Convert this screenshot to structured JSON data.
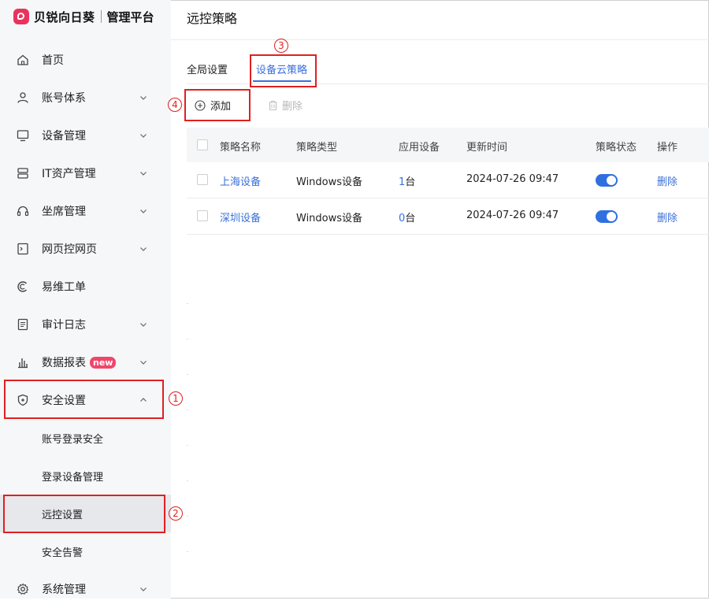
{
  "app": {
    "logo_text": "贝锐向日葵",
    "logo_sub": "管理平台"
  },
  "header": {
    "title": "远控策略"
  },
  "sidebar": {
    "items": [
      {
        "label": "首页",
        "icon": "home-icon"
      },
      {
        "label": "账号体系",
        "icon": "user-icon"
      },
      {
        "label": "设备管理",
        "icon": "monitor-icon"
      },
      {
        "label": "IT资产管理",
        "icon": "server-icon"
      },
      {
        "label": "坐席管理",
        "icon": "headset-icon"
      },
      {
        "label": "网页控网页",
        "icon": "terminal-icon"
      },
      {
        "label": "易维工单",
        "icon": "ticket-icon"
      },
      {
        "label": "审计日志",
        "icon": "log-icon"
      },
      {
        "label": "数据报表",
        "icon": "chart-icon",
        "badge": "new"
      },
      {
        "label": "安全设置",
        "icon": "shield-icon"
      },
      {
        "label": "系统管理",
        "icon": "gear-icon"
      }
    ],
    "security_sub": [
      "账号登录安全",
      "登录设备管理",
      "远控设置",
      "安全告警"
    ]
  },
  "tabs": [
    "全局设置",
    "设备云策略"
  ],
  "toolbar": {
    "add_label": "添加",
    "delete_label": "删除"
  },
  "table": {
    "headers": [
      "策略名称",
      "策略类型",
      "应用设备",
      "更新时间",
      "策略状态",
      "操作"
    ],
    "rows": [
      {
        "name": "上海设备",
        "type": "Windows设备",
        "count": "1",
        "unit": "台",
        "updated": "2024-07-26 09:47",
        "enabled": true,
        "action": "删除"
      },
      {
        "name": "深圳设备",
        "type": "Windows设备",
        "count": "0",
        "unit": "台",
        "updated": "2024-07-26 09:47",
        "enabled": true,
        "action": "删除"
      }
    ]
  },
  "annotations": [
    "1",
    "2",
    "3",
    "4"
  ]
}
